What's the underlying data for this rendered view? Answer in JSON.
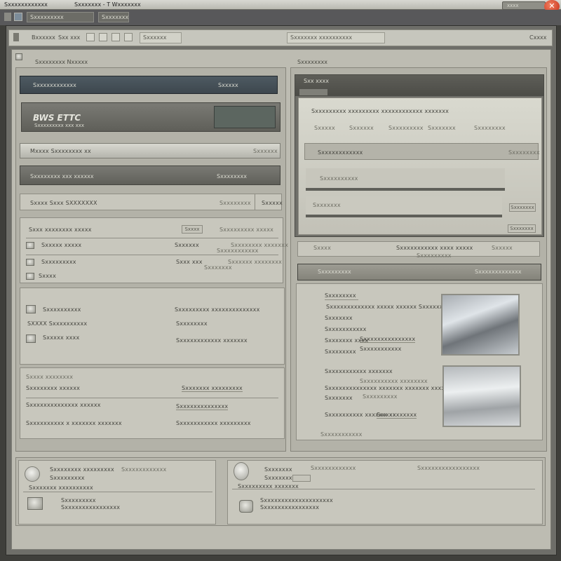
{
  "window": {
    "title": "Sxxxxxxxxxxxx",
    "subtitle": "Sxxxxxxx - T Wxxxxxxx",
    "tabs": [
      "Sxxxxxxxxx",
      "Sxxxxxxx"
    ],
    "controls_label": "xxxx"
  },
  "toolbar": {
    "items": [
      "Bxxxxxx",
      "Sxx xxx"
    ],
    "field_label": "Sxxxxxx",
    "center_tab": "Sxxxxxxx xxxxxxxxxx",
    "help_label": "Cxxxx"
  },
  "left": {
    "header": "Sxxxxxxxx Nxxxxx",
    "selected_row": {
      "label": "Sxxxxxxxxxxxx",
      "value": "Sxxxxx"
    },
    "banner": {
      "logo": "BWS ETTC",
      "sub": "Sxxxxxxxxx xxx xxx"
    },
    "bar_light": {
      "label": "Mxxxx Sxxxxxxxx xx",
      "value": "Sxxxxxx"
    },
    "bar_dark": {
      "label": "Sxxxxxxxx xxx xxxxxx",
      "value": "Sxxxxxxxx"
    },
    "tab_row": {
      "label": "Sxxxx Sxxx SXXXXXXX",
      "mid": "Sxxxxxxxx",
      "right": "Sxxxxx"
    },
    "group1": {
      "title": "Sxxx xxxxxxxx xxxxx",
      "title_btn": "Sxxxx",
      "title_right": "Sxxxxxxxxx xxxxx",
      "rows": [
        {
          "a": "Sxxxxx xxxxx",
          "b": "Sxxxxxx",
          "c": "Sxxxxxxxxxxx",
          "d": "Sxxxxxxxx xxxxxxx"
        },
        {
          "a": "Sxxxxxxxxx",
          "b": "Sxxx xxx",
          "c": "Sxxxxxxx",
          "d": "Sxxxxxx xxxxxxxx"
        },
        {
          "a": "Sxxxx",
          "b": "",
          "c": "",
          "d": ""
        }
      ]
    },
    "group2": {
      "rows": [
        {
          "a": "Sxxxxxxxxxx",
          "b": "Sxxxxxxxxx xxxxxxxxxxxxxx"
        },
        {
          "a": "SXXXX Sxxxxxxxxxx",
          "b": "Sxxxxxxxx"
        },
        {
          "a": "Sxxxxx xxxx",
          "b": "Sxxxxxxxxxxxx xxxxxxx"
        }
      ]
    },
    "group3": {
      "title": "Sxxxx xxxxxxxx",
      "rows": [
        {
          "a": "Sxxxxxxxx xxxxxx",
          "b": "Sxxxxxxx xxxxxxxxx"
        },
        {
          "a": "Sxxxxxxxxxxxxxx xxxxxx",
          "b": "Sxxxxxxxxxxxxxx"
        },
        {
          "a": "Sxxxxxxxxxx x xxxxxxx xxxxxxx",
          "b": "Sxxxxxxxxxxx xxxxxxxxx"
        }
      ]
    }
  },
  "right": {
    "header": "Sxxxxxxxx",
    "sub_tab": "Sxx xxxx",
    "dialog": {
      "top_line": "Sxxxxxxxxx xxxxxxxxx xxxxxxxxxxxx xxxxxxx",
      "fields": [
        "Sxxxxx",
        "Sxxxxxx",
        "Sxxxxxxxxx",
        "Sxxxxxxx",
        "Sxxxxxxxx"
      ],
      "row1": "Sxxxxxxxxxxxx",
      "row1_right": "Sxxxxxxxx",
      "row2": "Sxxxxxxxxxx",
      "row3": "Sxxxxxxx",
      "row3_btn": "Sxxxxxxx",
      "bottom_btn": "Sxxxxxxx"
    },
    "strip1": {
      "left": "Sxxxx",
      "mid": "Sxxxxxxxxxxx xxxx xxxxx",
      "right": "Sxxxxx"
    },
    "strip1_sub": "Sxxxxxxxxx",
    "strip2": {
      "left": "Sxxxxxxxxx",
      "right": "Sxxxxxxxxxxxxx"
    },
    "details": {
      "top": "Sxxxxxxxx",
      "lines": [
        {
          "a": "Sxxxxxxxxxxxxx xxxxx xxxxxx Sxxxxxxxxxxx",
          "b": ""
        },
        {
          "a": "Sxxxxxxx",
          "b": ""
        },
        {
          "a": "Sxxxxxxxxxxx",
          "b": ""
        },
        {
          "a": "Sxxxxxxx xxxx",
          "b": "Sxxxxxxxxxxxxxxx"
        },
        {
          "a": "Sxxxxxxxx",
          "b": "Sxxxxxxxxxxx"
        },
        {
          "a": "Sxxxxxxxxxxx xxxxxxx",
          "b": "Sxxxxxxxxxx xxxxxxxx"
        },
        {
          "a": "Sxxxxxxxxxxxxxx xxxxxxx xxxxxxx xxxxxxxxxxxxx",
          "b": ""
        },
        {
          "a": "Sxxxxxxx",
          "b": "Sxxxxxxxxx"
        },
        {
          "a": "Sxxxxxxxxxx xxxxxxxxx",
          "b": "Sxx xxxxxxxx"
        }
      ],
      "footer": "Sxxxxxxxxxxx"
    }
  },
  "bottom": {
    "left": {
      "title": "Sxxxxxxxx xxxxxxxxx",
      "title_right": "Sxxxxxxxxxxxx",
      "line2": "Sxxxxxxxxx",
      "line3": "Sxxxxxxx xxxxxxxxxx",
      "item": "Sxxxxxxxxx",
      "item_sub": "Sxxxxxxxxxxxxxxxx"
    },
    "right": {
      "title": "Sxxxxxxx",
      "title_mid": "Sxxxxxxxxxxxx",
      "title_right": "Sxxxxxxxxxxxxxxxxx",
      "line2": "Sxxxxxxxxx",
      "line3": "Sxxxxxxxxx xxxxxxx",
      "item": "Sxxxxxxxxxxxxxxxxxxxx",
      "item_sub": "Sxxxxxxxxxxxxxxxx"
    }
  },
  "colors": {
    "background": "#3f3f3b",
    "panel": "#b3b2a8",
    "dark_bar": "#4e5a62",
    "close_button": "#c8301a"
  }
}
